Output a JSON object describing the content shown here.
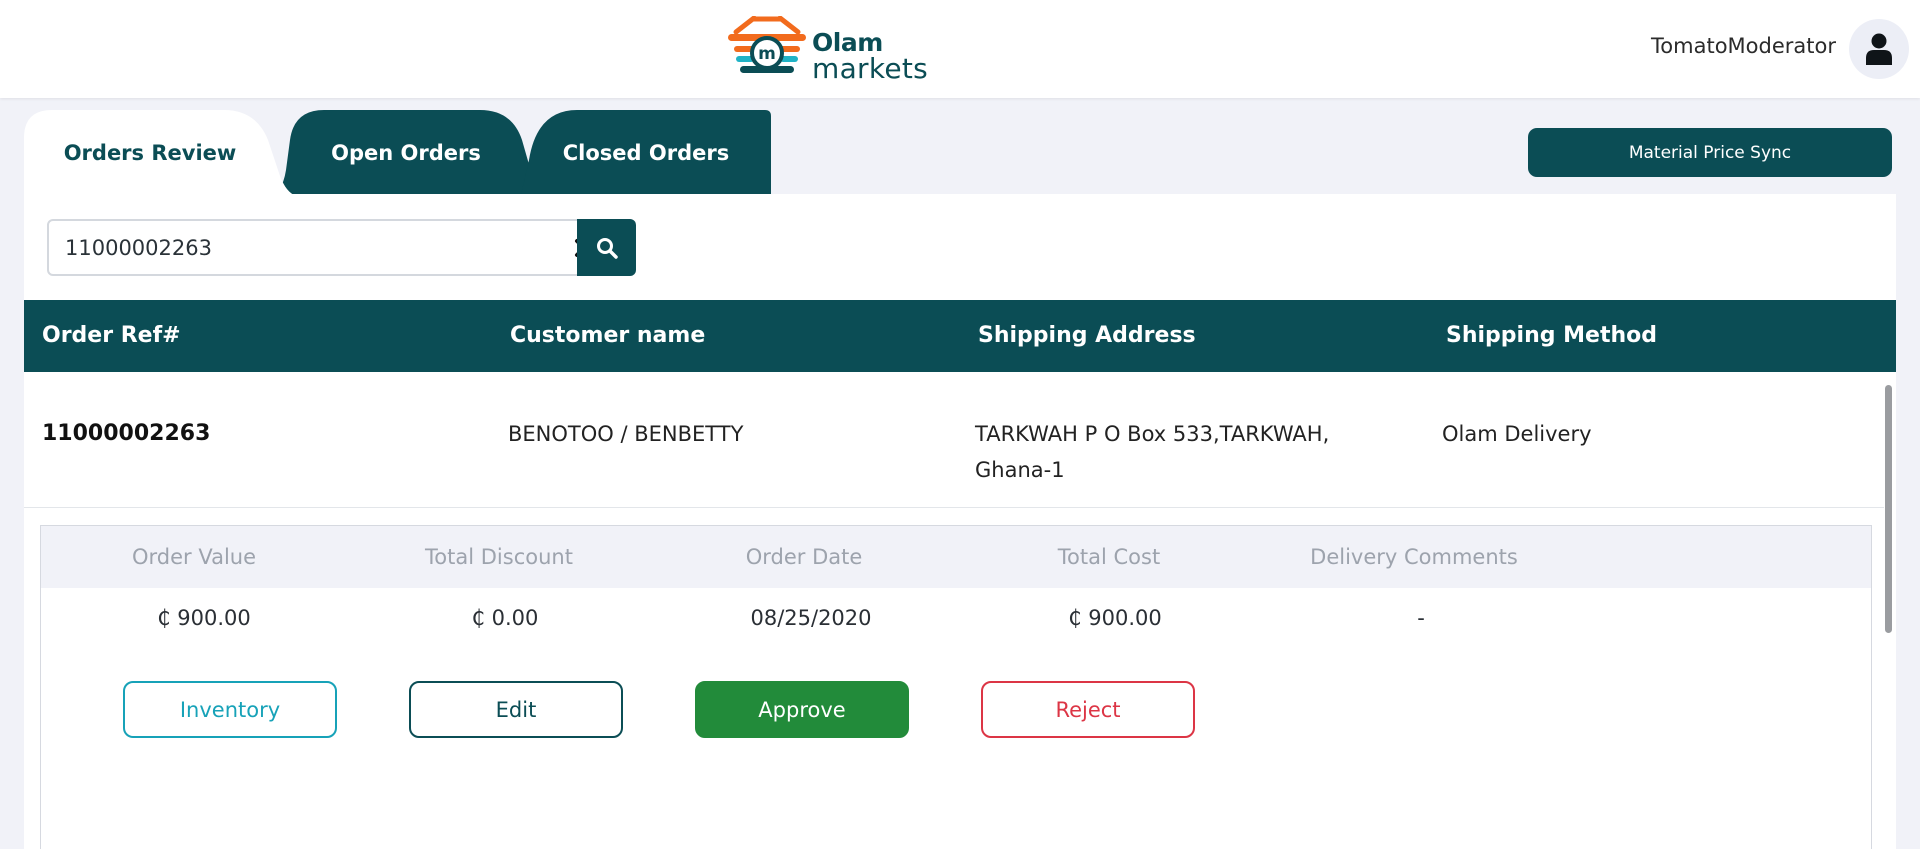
{
  "header": {
    "logo_line1": "Olam",
    "logo_line2": "markets",
    "username": "TomatoModerator"
  },
  "tabs": [
    {
      "label": "Orders Review",
      "active": true
    },
    {
      "label": "Open Orders",
      "active": false
    },
    {
      "label": "Closed Orders",
      "active": false
    }
  ],
  "sync_button": "Material Price Sync",
  "search": {
    "value": "11000002263"
  },
  "table": {
    "headers": [
      "Order Ref#",
      "Customer name",
      "Shipping Address",
      "Shipping Method"
    ],
    "row": {
      "ref": "11000002263",
      "customer": "BENOTOO / BENBETTY",
      "address_line1": "TARKWAH P O Box 533,TARKWAH,",
      "address_line2": "Ghana-1",
      "method": "Olam Delivery"
    }
  },
  "details": {
    "headers": [
      "Order Value",
      "Total Discount",
      "Order Date",
      "Total Cost",
      "Delivery Comments"
    ],
    "values": [
      "₵ 900.00",
      "₵ 0.00",
      "08/25/2020",
      "₵ 900.00",
      "-"
    ]
  },
  "actions": {
    "inventory": "Inventory",
    "edit": "Edit",
    "approve": "Approve",
    "reject": "Reject"
  },
  "colors": {
    "primary": "#0b4d55",
    "approve": "#228b3a",
    "reject": "#dc3545",
    "inventory": "#17a2b8"
  }
}
